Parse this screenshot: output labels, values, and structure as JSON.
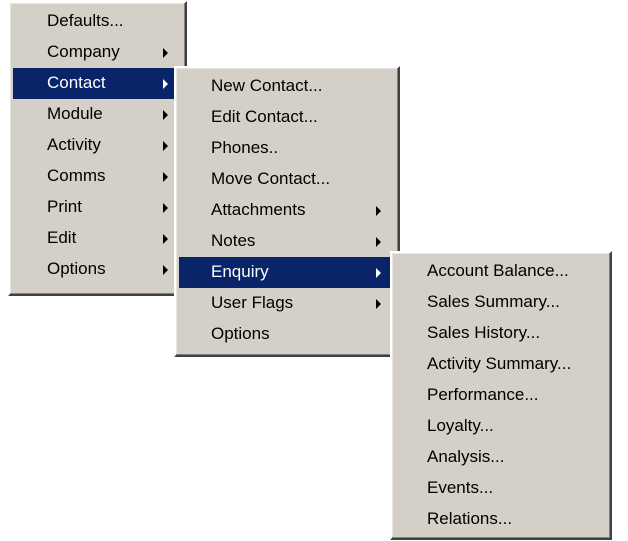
{
  "main_menu": {
    "items": [
      {
        "label": "Defaults..."
      },
      {
        "label": "Company"
      },
      {
        "label": "Contact"
      },
      {
        "label": "Module"
      },
      {
        "label": "Activity"
      },
      {
        "label": "Comms"
      },
      {
        "label": "Print"
      },
      {
        "label": "Edit"
      },
      {
        "label": "Options"
      }
    ]
  },
  "contact_menu": {
    "items": [
      {
        "label": "New Contact..."
      },
      {
        "label": "Edit Contact..."
      },
      {
        "label": "Phones.."
      },
      {
        "label": "Move Contact..."
      },
      {
        "label": "Attachments"
      },
      {
        "label": "Notes"
      },
      {
        "label": "Enquiry"
      },
      {
        "label": "User Flags"
      },
      {
        "label": "Options"
      }
    ]
  },
  "enquiry_menu": {
    "items": [
      {
        "label": "Account Balance..."
      },
      {
        "label": "Sales Summary..."
      },
      {
        "label": "Sales History..."
      },
      {
        "label": "Activity Summary..."
      },
      {
        "label": "Performance..."
      },
      {
        "label": "Loyalty..."
      },
      {
        "label": "Analysis..."
      },
      {
        "label": "Events..."
      },
      {
        "label": "Relations..."
      }
    ]
  },
  "icons": {
    "submenu_arrow": "submenu-arrow-icon"
  },
  "colors": {
    "menu_background": "#d4d0c8",
    "highlight_background": "#0a246a",
    "highlight_text": "#ffffff"
  }
}
